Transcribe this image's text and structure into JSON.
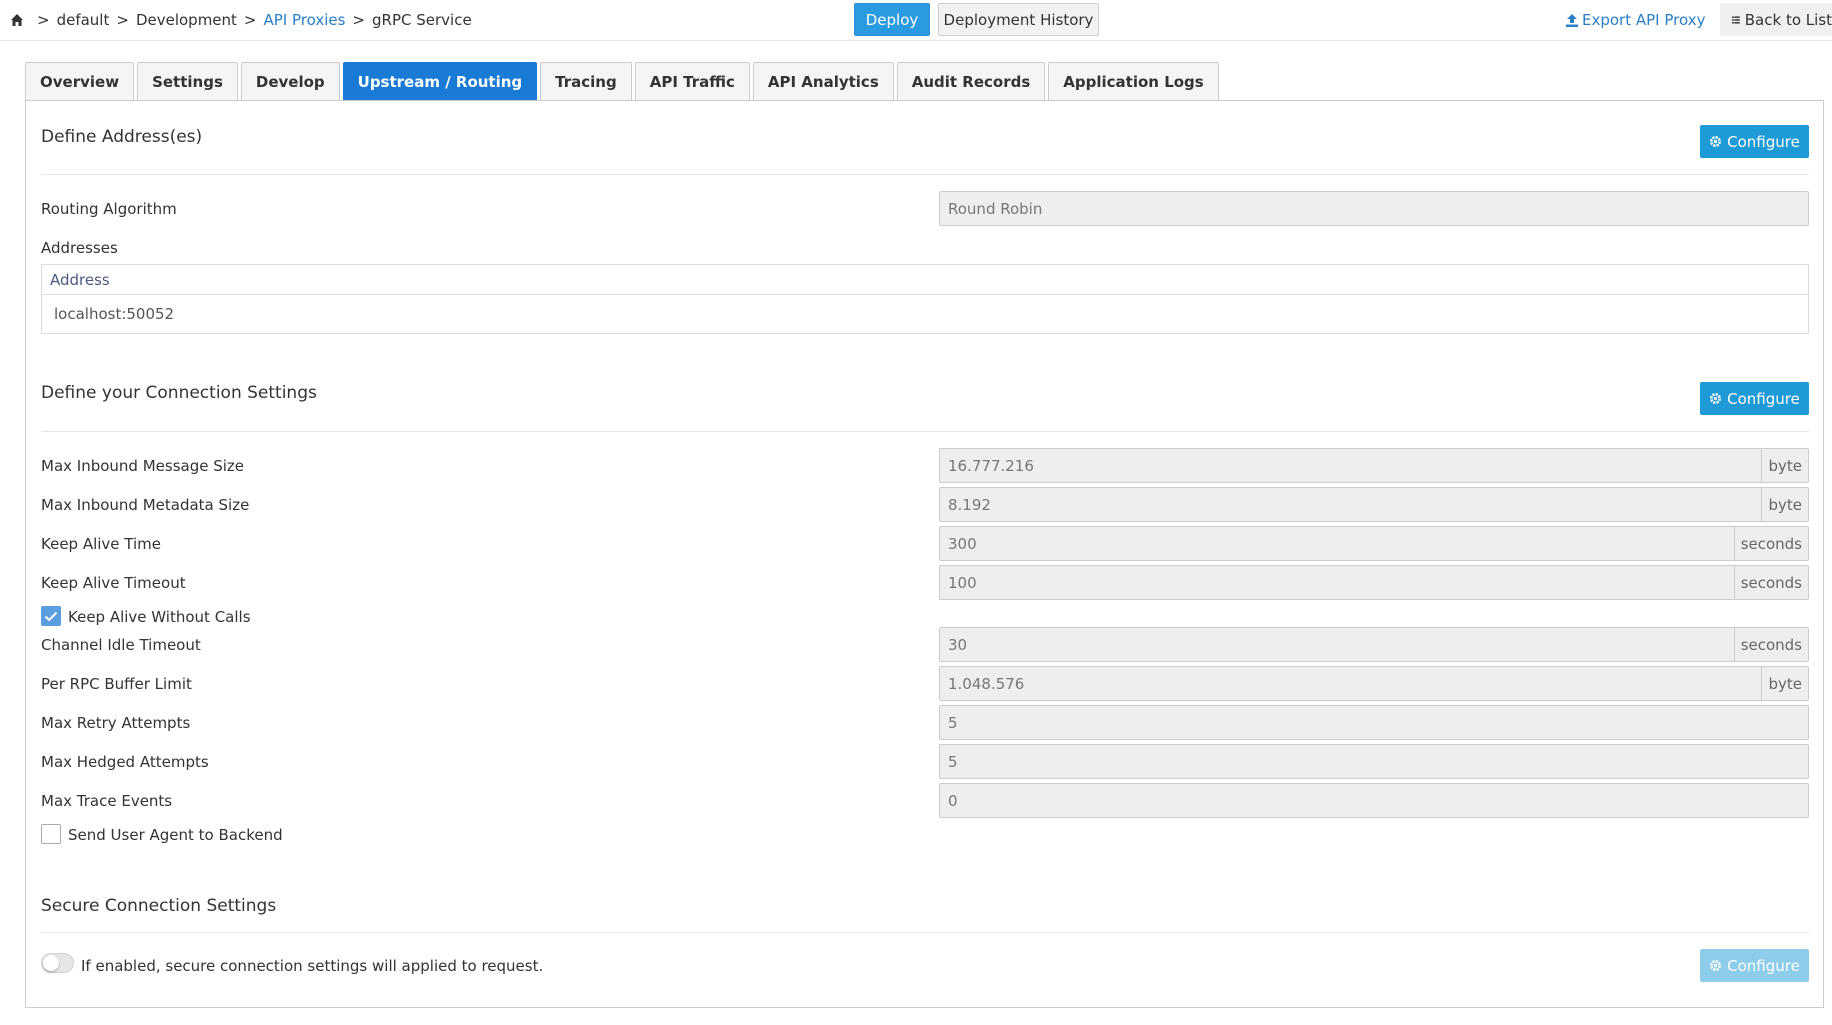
{
  "breadcrumb": {
    "items": [
      "default",
      "Development",
      "API Proxies",
      "gRPC Service"
    ],
    "separator": ">"
  },
  "header": {
    "deploy_label": "Deploy",
    "history_label": "Deployment History",
    "export_label": "Export API Proxy",
    "back_label": "Back to List"
  },
  "tabs": [
    {
      "label": "Overview"
    },
    {
      "label": "Settings"
    },
    {
      "label": "Develop"
    },
    {
      "label": "Upstream / Routing",
      "active": true
    },
    {
      "label": "Tracing"
    },
    {
      "label": "API Traffic"
    },
    {
      "label": "API Analytics"
    },
    {
      "label": "Audit Records"
    },
    {
      "label": "Application Logs"
    }
  ],
  "addresses_section": {
    "title": "Define Address(es)",
    "configure_label": "Configure",
    "routing_label": "Routing Algorithm",
    "routing_value": "Round Robin",
    "addresses_label": "Addresses",
    "table_header": "Address",
    "rows": [
      "localhost:50052"
    ]
  },
  "connection_section": {
    "title": "Define your Connection Settings",
    "configure_label": "Configure",
    "max_inbound_message_size": {
      "label": "Max Inbound Message Size",
      "value": "16.777.216",
      "unit": "byte"
    },
    "max_inbound_metadata_size": {
      "label": "Max Inbound Metadata Size",
      "value": "8.192",
      "unit": "byte"
    },
    "keep_alive_time": {
      "label": "Keep Alive Time",
      "value": "300",
      "unit": "seconds"
    },
    "keep_alive_timeout": {
      "label": "Keep Alive Timeout",
      "value": "100",
      "unit": "seconds"
    },
    "keep_alive_without_calls": {
      "label": "Keep Alive Without Calls",
      "checked": true
    },
    "channel_idle_timeout": {
      "label": "Channel Idle Timeout",
      "value": "30",
      "unit": "seconds"
    },
    "per_rpc_buffer_limit": {
      "label": "Per RPC Buffer Limit",
      "value": "1.048.576",
      "unit": "byte"
    },
    "max_retry_attempts": {
      "label": "Max Retry Attempts",
      "value": "5"
    },
    "max_hedged_attempts": {
      "label": "Max Hedged Attempts",
      "value": "5"
    },
    "max_trace_events": {
      "label": "Max Trace Events",
      "value": "0"
    },
    "send_user_agent": {
      "label": "Send User Agent to Backend",
      "checked": false
    }
  },
  "secure_section": {
    "title": "Secure Connection Settings",
    "toggle_label": "If enabled, secure connection settings will applied to request.",
    "enabled": false,
    "configure_label": "Configure"
  },
  "colors": {
    "primary": "#1e9ad6",
    "active_tab": "#1a7bd6",
    "link": "#2a7fc9"
  }
}
